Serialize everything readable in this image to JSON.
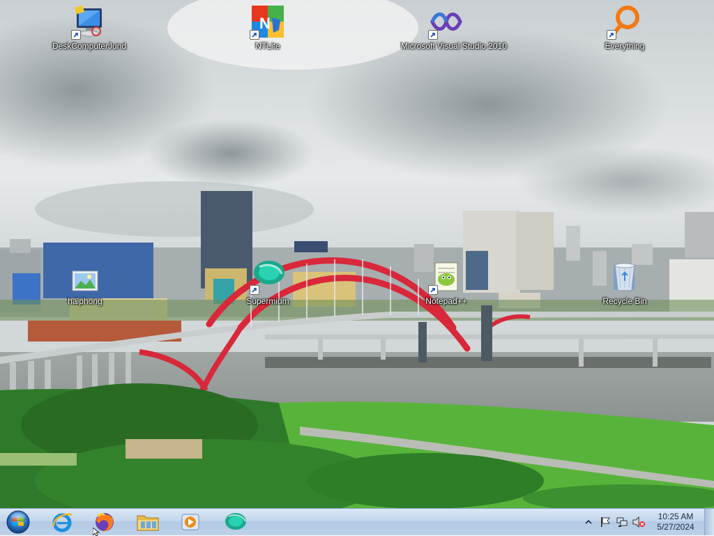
{
  "desktop": {
    "icons": [
      {
        "label": "DeskComputerJund",
        "icon": "computer-monitor-icon"
      },
      {
        "label": "NTLite",
        "icon": "ntlite-icon"
      },
      {
        "label": "Microsoft Visual Studio 2010",
        "icon": "visual-studio-icon"
      },
      {
        "label": "Everything",
        "icon": "everything-search-icon"
      },
      {
        "label": "haiphong",
        "icon": "image-file-icon"
      },
      {
        "label": "Supermium",
        "icon": "supermium-browser-icon"
      },
      {
        "label": "Notepad++",
        "icon": "notepadplusplus-icon"
      },
      {
        "label": "Recycle Bin",
        "icon": "recycle-bin-icon"
      }
    ]
  },
  "taskbar": {
    "start_icon": "windows-start-orb-icon",
    "pinned": [
      {
        "name": "Internet Explorer",
        "icon": "internet-explorer-icon"
      },
      {
        "name": "Firefox",
        "icon": "firefox-icon"
      },
      {
        "name": "Windows Explorer",
        "icon": "folder-explorer-icon"
      },
      {
        "name": "Windows Media Player",
        "icon": "media-player-icon"
      },
      {
        "name": "Supermium",
        "icon": "supermium-browser-icon"
      }
    ],
    "tray": {
      "icons": [
        "show-hidden-icons-chevron-icon",
        "action-center-flag-icon",
        "network-icon",
        "volume-muted-icon"
      ],
      "time": "10:25 AM",
      "date": "5/27/2024"
    }
  },
  "colors": {
    "taskbar_top": "#dbe7f4",
    "taskbar_bottom": "#b2c9e4",
    "bridge_red": "#d8283a"
  }
}
